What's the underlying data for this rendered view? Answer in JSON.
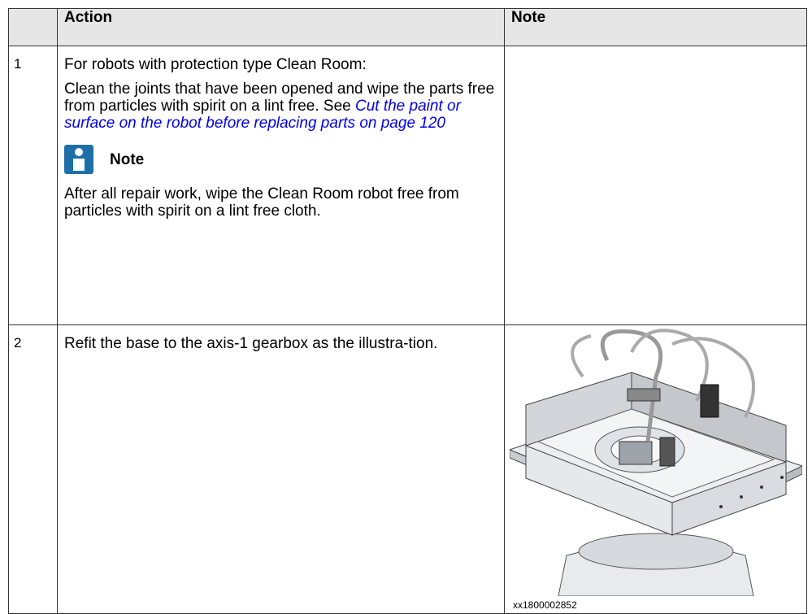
{
  "table": {
    "headers": {
      "blank": "",
      "action": "Action",
      "note": "Note"
    },
    "rows": [
      {
        "number": "1",
        "action_intro": "For robots with protection type Clean Room:",
        "action_text": "Clean the joints that have been opened and wipe the parts free from particles with spirit on a lint free. See ",
        "link_text": "Cut the paint or surface on the robot before replacing parts on page 120",
        "note_label": "Note",
        "note_text": "After all repair work, wipe the Clean Room robot free from particles with spirit on a lint free cloth."
      },
      {
        "number": "2",
        "action_text": "Refit the base to the axis-1 gearbox as the illustra-tion.",
        "image_caption": "xx1800002852"
      }
    ]
  },
  "colors": {
    "header_bg": "#e6e6e6",
    "link": "#0000ee",
    "note_icon": "#1e6fa8"
  }
}
